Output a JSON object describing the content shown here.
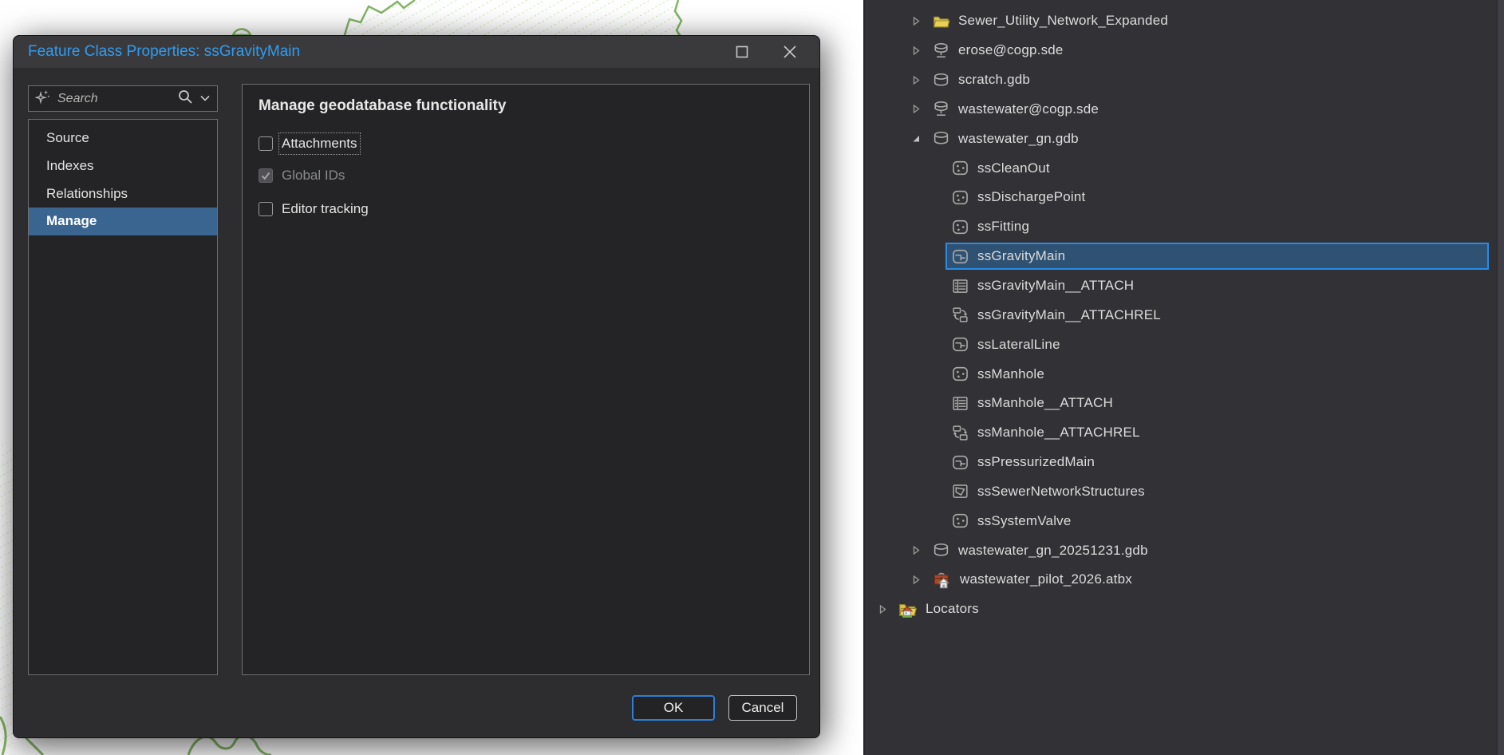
{
  "colors": {
    "title_blue": "#2f9cf0",
    "nav_selected": "#3a6591",
    "selection_fill": "#2f5273",
    "selection_border": "#2a8ce8",
    "ok_border": "#2b7fd9",
    "folder_yellow": "#d9c44a",
    "toolbox_red": "#a8492b",
    "map_boundary_green": "#84b566",
    "map_hatch_green": "#bfe5a6"
  },
  "dialog": {
    "title": "Feature Class Properties: ssGravityMain",
    "window_buttons": [
      "maximize-icon",
      "close-icon"
    ],
    "search_placeholder": "Search",
    "search_icons": [
      "sparkle-icon",
      "magnifier-icon",
      "chevron-down-icon"
    ],
    "nav": [
      {
        "label": "Source",
        "selected": false
      },
      {
        "label": "Indexes",
        "selected": false
      },
      {
        "label": "Relationships",
        "selected": false
      },
      {
        "label": "Manage",
        "selected": true
      }
    ],
    "heading": "Manage geodatabase functionality",
    "checkboxes": [
      {
        "label": "Attachments",
        "checked": false,
        "disabled": false,
        "focused": true
      },
      {
        "label": "Global IDs",
        "checked": true,
        "disabled": true,
        "focused": false
      },
      {
        "label": "Editor tracking",
        "checked": false,
        "disabled": false,
        "focused": false
      }
    ],
    "ok_label": "OK",
    "cancel_label": "Cancel"
  },
  "catalog": {
    "items": [
      {
        "label": "Sewer_Utility_Network_Expanded",
        "icon": "folder",
        "level": 1,
        "arrow": "collapsed",
        "selected": false
      },
      {
        "label": "erose@cogp.sde",
        "icon": "sde",
        "level": 1,
        "arrow": "collapsed",
        "selected": false
      },
      {
        "label": "scratch.gdb",
        "icon": "gdb",
        "level": 1,
        "arrow": "collapsed",
        "selected": false
      },
      {
        "label": "wastewater@cogp.sde",
        "icon": "sde",
        "level": 1,
        "arrow": "collapsed",
        "selected": false
      },
      {
        "label": "wastewater_gn.gdb",
        "icon": "gdb",
        "level": 1,
        "arrow": "expanded",
        "selected": false
      },
      {
        "label": "ssCleanOut",
        "icon": "point-fc",
        "level": 2,
        "arrow": "none",
        "selected": false
      },
      {
        "label": "ssDischargePoint",
        "icon": "point-fc",
        "level": 2,
        "arrow": "none",
        "selected": false
      },
      {
        "label": "ssFitting",
        "icon": "point-fc",
        "level": 2,
        "arrow": "none",
        "selected": false
      },
      {
        "label": "ssGravityMain",
        "icon": "line-fc",
        "level": 2,
        "arrow": "none",
        "selected": true
      },
      {
        "label": "ssGravityMain__ATTACH",
        "icon": "table",
        "level": 2,
        "arrow": "none",
        "selected": false
      },
      {
        "label": "ssGravityMain__ATTACHREL",
        "icon": "relationship",
        "level": 2,
        "arrow": "none",
        "selected": false
      },
      {
        "label": "ssLateralLine",
        "icon": "line-fc",
        "level": 2,
        "arrow": "none",
        "selected": false
      },
      {
        "label": "ssManhole",
        "icon": "point-fc",
        "level": 2,
        "arrow": "none",
        "selected": false
      },
      {
        "label": "ssManhole__ATTACH",
        "icon": "table",
        "level": 2,
        "arrow": "none",
        "selected": false
      },
      {
        "label": "ssManhole__ATTACHREL",
        "icon": "relationship",
        "level": 2,
        "arrow": "none",
        "selected": false
      },
      {
        "label": "ssPressurizedMain",
        "icon": "line-fc",
        "level": 2,
        "arrow": "none",
        "selected": false
      },
      {
        "label": "ssSewerNetworkStructures",
        "icon": "polygon-fc",
        "level": 2,
        "arrow": "none",
        "selected": false
      },
      {
        "label": "ssSystemValve",
        "icon": "point-fc",
        "level": 2,
        "arrow": "none",
        "selected": false
      },
      {
        "label": "wastewater_gn_20251231.gdb",
        "icon": "gdb",
        "level": 1,
        "arrow": "collapsed",
        "selected": false
      },
      {
        "label": "wastewater_pilot_2026.atbx",
        "icon": "toolbox",
        "level": 1,
        "arrow": "collapsed",
        "selected": false
      },
      {
        "label": "Locators",
        "icon": "locators-folder",
        "level": 0,
        "arrow": "collapsed",
        "selected": false
      }
    ]
  }
}
